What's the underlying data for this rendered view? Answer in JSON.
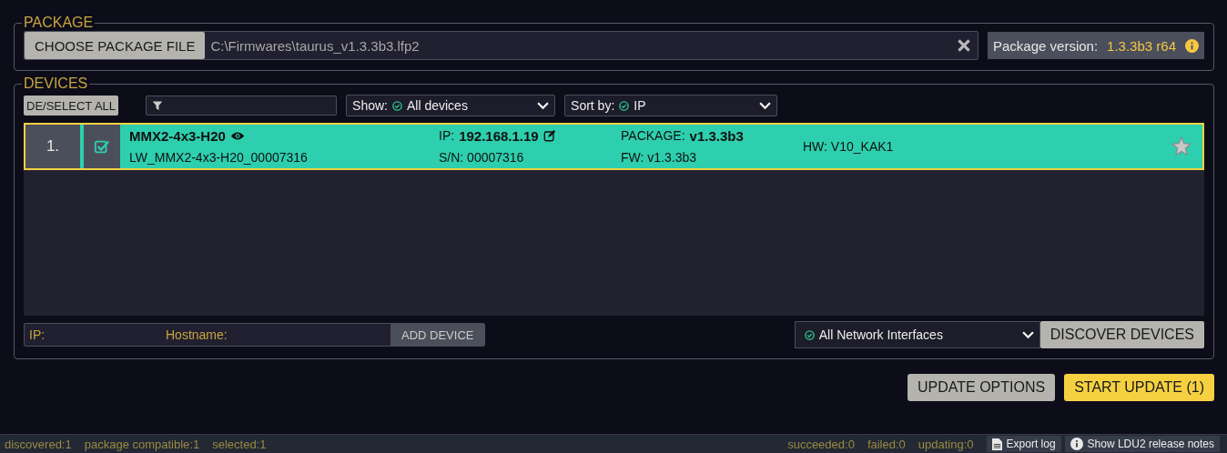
{
  "package": {
    "title": "PACKAGE",
    "choose_button": "CHOOSE PACKAGE FILE",
    "file_path": "C:\\Firmwares\\taurus_v1.3.3b3.lfp2",
    "version_label": "Package version:",
    "version_value": "1.3.3b3 r64"
  },
  "devices": {
    "title": "DEVICES",
    "select_all_button": "DE/SELECT ALL",
    "show": {
      "label": "Show:",
      "value": "All devices"
    },
    "sort": {
      "label": "Sort by:",
      "value": "IP"
    },
    "rows": [
      {
        "index": "1.",
        "checked": true,
        "selected": true,
        "starred": false,
        "name": "MMX2-4x3-H20",
        "hostname": "LW_MMX2-4x3-H20_00007316",
        "ip_label": "IP:",
        "ip": "192.168.1.19",
        "sn": "S/N: 00007316",
        "package_label": "PACKAGE:",
        "package": "v1.3.3b3",
        "fw": "FW: v1.3.3b3",
        "hw": "HW: V10_KAK1"
      }
    ],
    "ip_placeholder": "IP:",
    "hostname_placeholder": "Hostname:",
    "add_button": "ADD DEVICE",
    "interface": "All Network Interfaces",
    "discover_button": "DISCOVER DEVICES"
  },
  "actions": [
    {
      "label": "UPDATE OPTIONS",
      "kind": "secondary"
    },
    {
      "label": "START UPDATE (1)",
      "kind": "primary"
    }
  ],
  "status_bar": {
    "left": [
      "discovered:1",
      "package compatible:1",
      "selected:1"
    ],
    "right": [
      "succeeded:0",
      "failed:0",
      "updating:0"
    ],
    "export_log": "Export log",
    "release_notes": "Show LDU2 release notes"
  }
}
